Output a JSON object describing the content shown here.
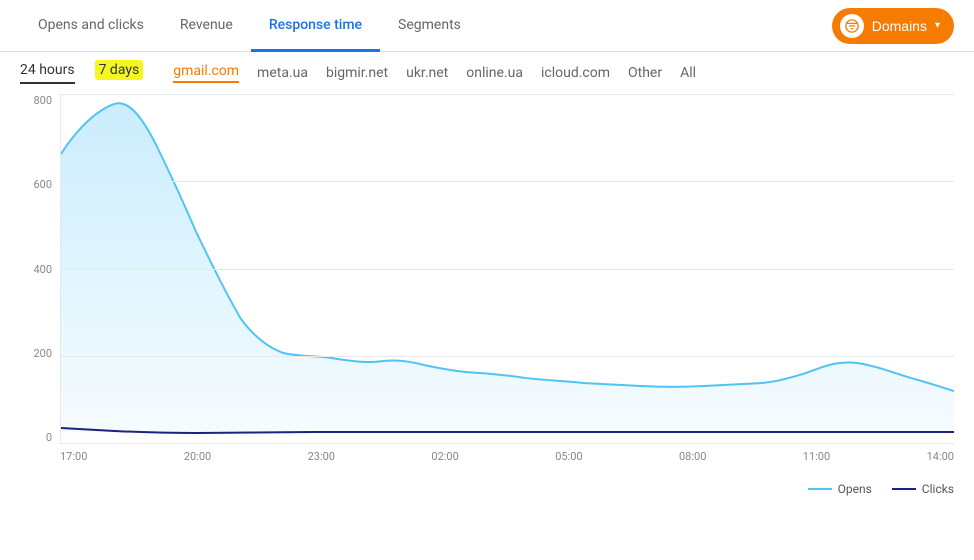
{
  "nav": {
    "tabs": [
      {
        "id": "opens-clicks",
        "label": "Opens and clicks",
        "active": false
      },
      {
        "id": "revenue",
        "label": "Revenue",
        "active": false
      },
      {
        "id": "response-time",
        "label": "Response time",
        "active": true
      },
      {
        "id": "segments",
        "label": "Segments",
        "active": false
      }
    ],
    "domains_button": "Domains"
  },
  "filters": {
    "time": [
      {
        "id": "24h",
        "label": "24 hours",
        "active": true
      },
      {
        "id": "7d",
        "label": "7 days",
        "active": false,
        "highlighted": true
      }
    ],
    "domains": [
      {
        "id": "gmail",
        "label": "gmail.com",
        "active": true
      },
      {
        "id": "meta",
        "label": "meta.ua",
        "active": false
      },
      {
        "id": "bigmir",
        "label": "bigmir.net",
        "active": false
      },
      {
        "id": "ukrnet",
        "label": "ukr.net",
        "active": false
      },
      {
        "id": "online",
        "label": "online.ua",
        "active": false
      },
      {
        "id": "icloud",
        "label": "icloud.com",
        "active": false
      },
      {
        "id": "other",
        "label": "Other",
        "active": false
      },
      {
        "id": "all",
        "label": "All",
        "active": false
      }
    ]
  },
  "chart": {
    "y_labels": [
      "800",
      "600",
      "400",
      "200",
      "0"
    ],
    "x_labels": [
      "17:00",
      "20:00",
      "23:00",
      "02:00",
      "05:00",
      "08:00",
      "11:00",
      "14:00"
    ],
    "grid_lines": [
      0,
      1,
      2,
      3,
      4
    ]
  },
  "legend": {
    "opens_label": "Opens",
    "clicks_label": "Clicks"
  }
}
